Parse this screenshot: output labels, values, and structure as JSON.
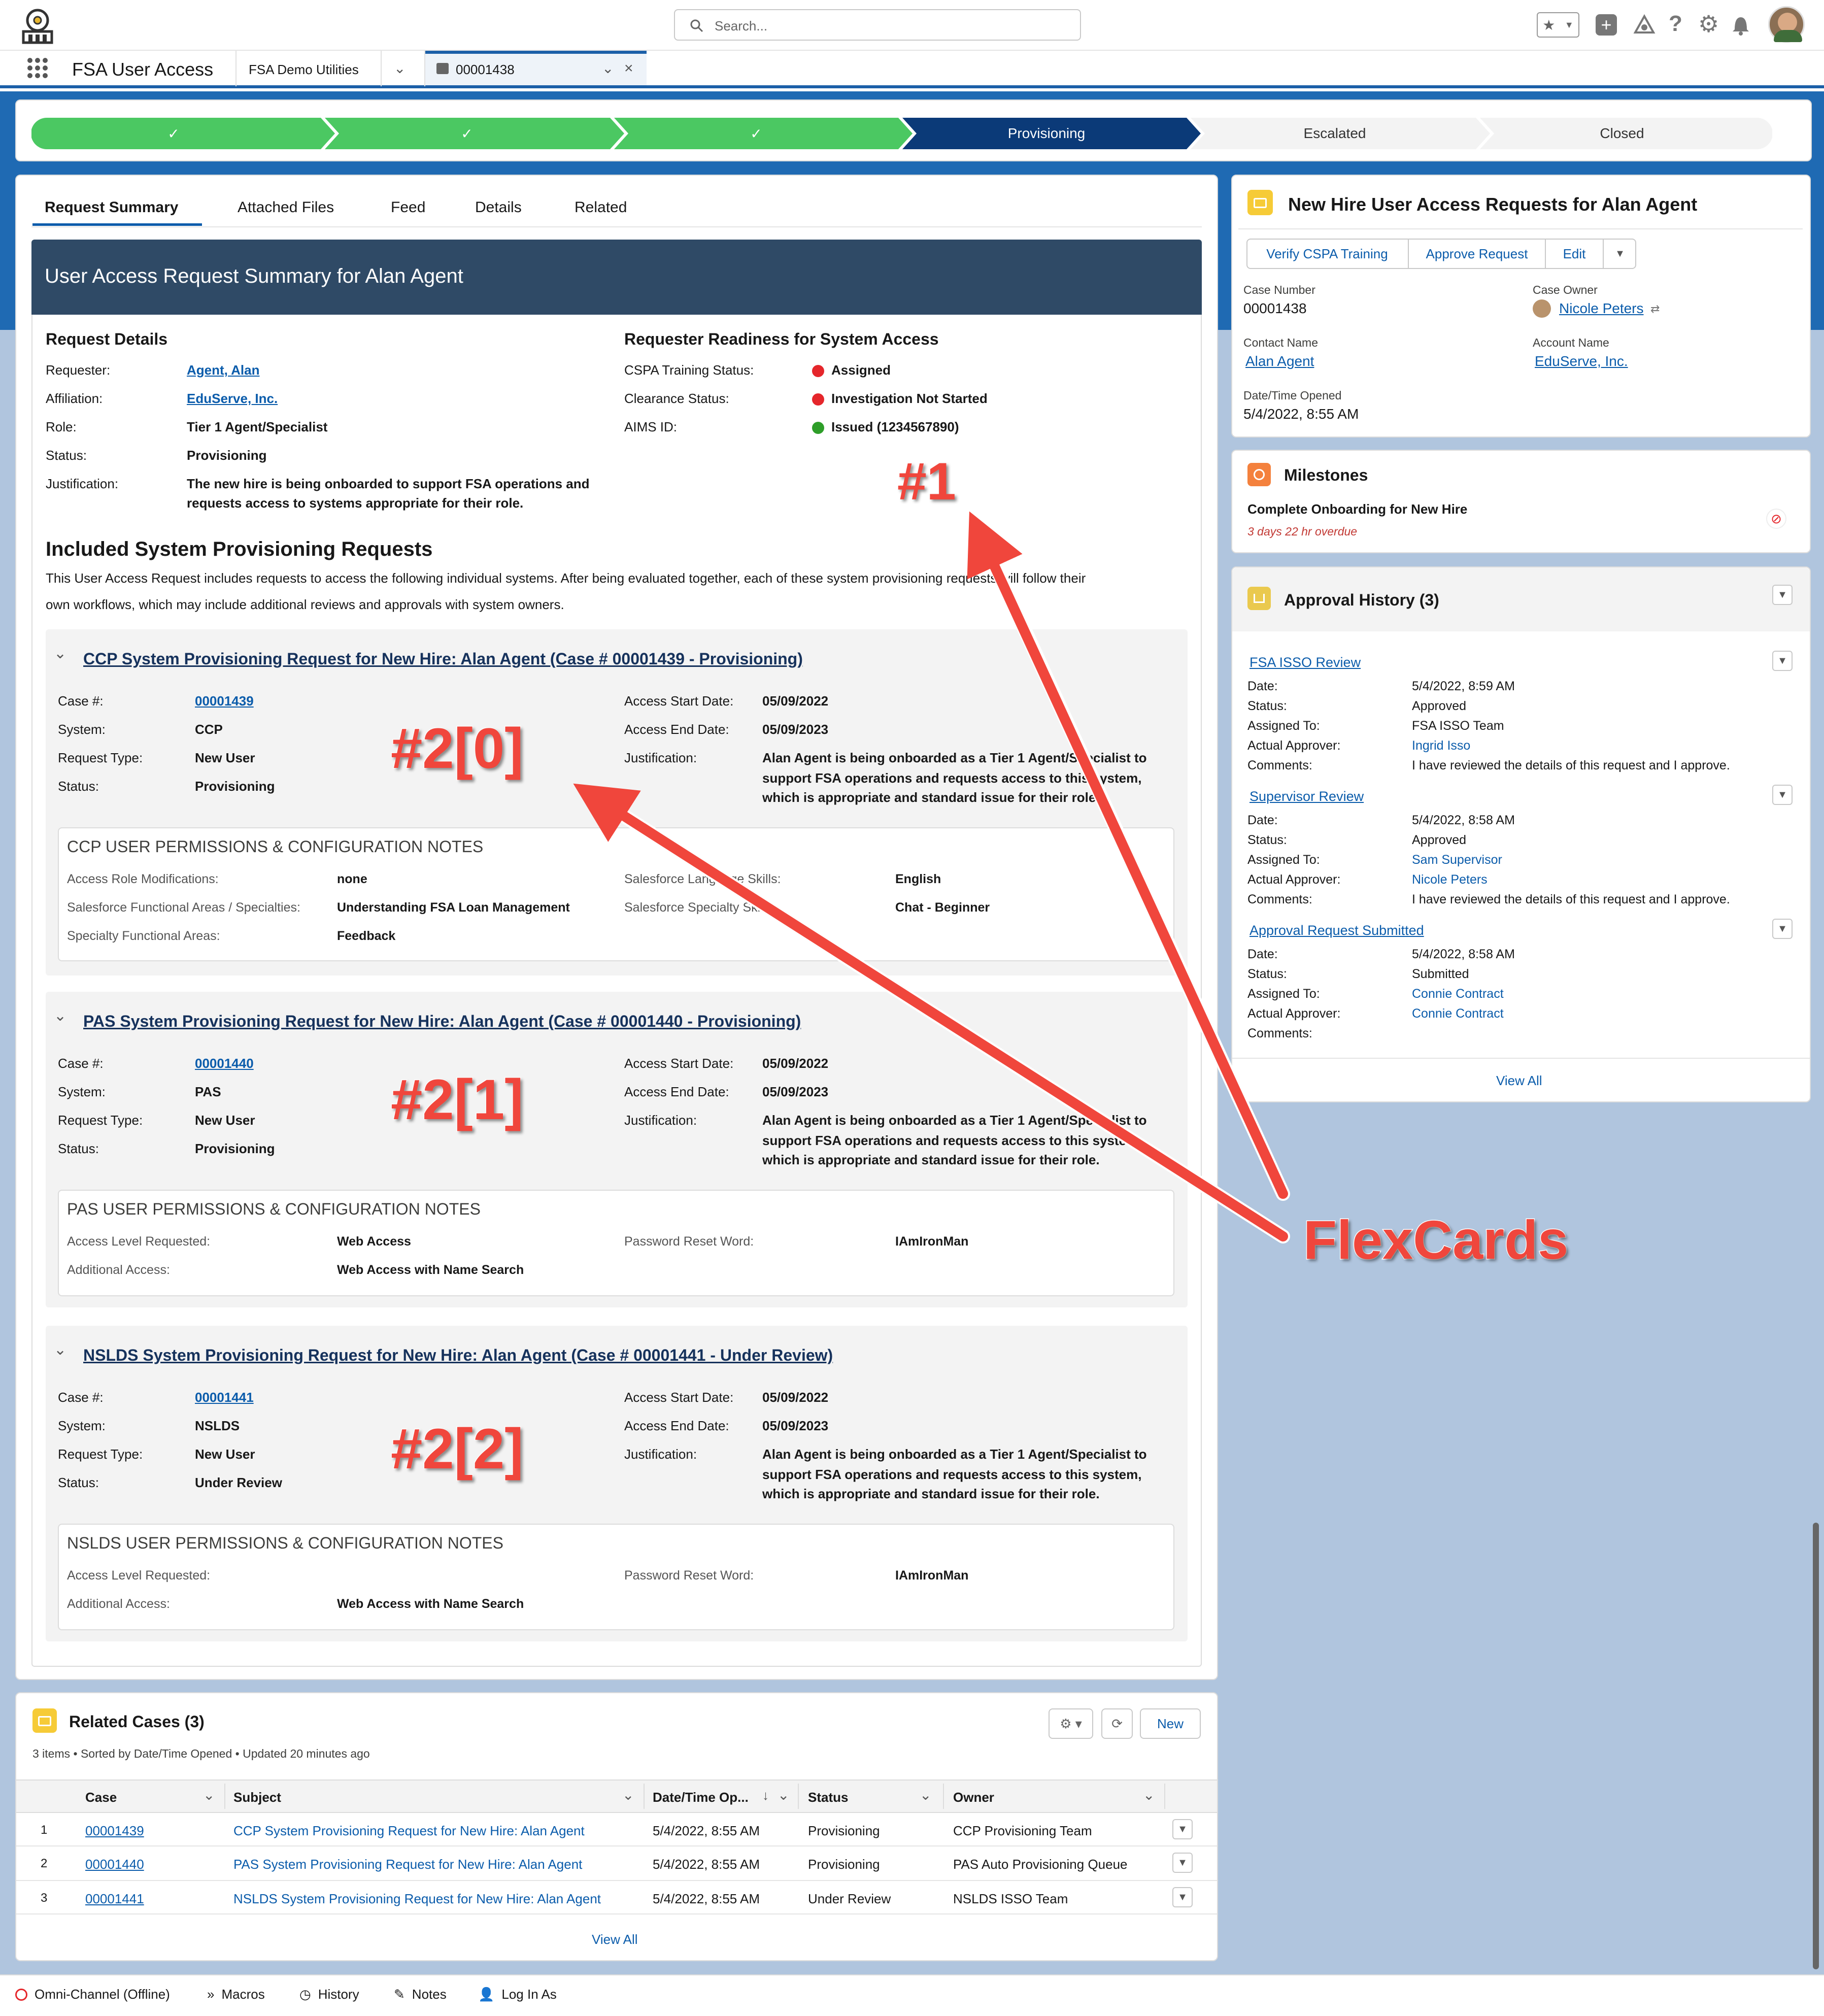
{
  "header": {
    "search_placeholder": "Search..."
  },
  "nav": {
    "app_name": "FSA User Access",
    "tab1": "FSA Demo Utilities",
    "tab2": "00001438"
  },
  "path": {
    "steps": [
      "✓",
      "✓",
      "✓",
      "Provisioning",
      "Escalated",
      "Closed"
    ]
  },
  "tabs": [
    "Request Summary",
    "Attached Files",
    "Feed",
    "Details",
    "Related"
  ],
  "summary": {
    "banner": "User Access Request Summary for Alan Agent",
    "details_title": "Request Details",
    "readiness_title": "Requester Readiness for System Access",
    "details": [
      {
        "label": "Requester:",
        "value": "Agent, Alan"
      },
      {
        "label": "Affiliation:",
        "value": "EduServe, Inc."
      },
      {
        "label": "Role:",
        "value": "Tier 1 Agent/Specialist"
      },
      {
        "label": "Status:",
        "value": "Provisioning"
      },
      {
        "label": "Justification:",
        "value": "The new hire is being onboarded to support FSA operations and",
        "value2": "requests access to systems appropriate for their role."
      }
    ],
    "readiness": [
      {
        "label": "CSPA Training Status:",
        "value": "Assigned",
        "color": "#e5262b"
      },
      {
        "label": "Clearance Status:",
        "value": "Investigation Not Started",
        "color": "#e5262b"
      },
      {
        "label": "AIMS ID:",
        "value": "Issued (1234567890)",
        "color": "#2e9e29"
      }
    ],
    "included_title": "Included System Provisioning Requests",
    "included_text1": "This User Access Request includes requests to access the following individual systems.  After being evaluated together, each of these system provisioning requests will follow their",
    "included_text2": "own workflows, which may include additional reviews and approvals with system owners."
  },
  "labels": {
    "case": "Case #:",
    "system": "System:",
    "req_type": "Request Type:",
    "status": "Status:",
    "start": "Access Start Date:",
    "end": "Access End Date:",
    "just": "Justification:"
  },
  "systems": [
    {
      "title": "CCP System Provisioning Request for New Hire: Alan Agent (Case # 00001439 - Provisioning)",
      "case": "00001439",
      "system": "CCP",
      "req_type": "New User",
      "status": "Provisioning",
      "start": "05/09/2022",
      "end": "05/09/2023",
      "just1": "Alan Agent is being onboarded as a Tier 1 Agent/Specialist to",
      "just2": "support FSA operations and requests access to this system,",
      "just3": "which is appropriate and standard issue for their role.",
      "notes_title": "CCP USER PERMISSIONS & CONFIGURATION NOTES",
      "notes": [
        {
          "l": "Access Role Modifications:",
          "v": "none",
          "l2": "Salesforce Language Skills:",
          "v2": "English"
        },
        {
          "l": "Salesforce Functional Areas / Specialties:",
          "v": "Understanding FSA Loan Management",
          "l2": "Salesforce Specialty Skills:",
          "v2": "Chat - Beginner"
        },
        {
          "l": "Specialty Functional Areas:",
          "v": "Feedback",
          "l2": "",
          "v2": ""
        }
      ]
    },
    {
      "title": "PAS System Provisioning Request for New Hire: Alan Agent (Case # 00001440 - Provisioning)",
      "case": "00001440",
      "system": "PAS",
      "req_type": "New User",
      "status": "Provisioning",
      "start": "05/09/2022",
      "end": "05/09/2023",
      "just1": "Alan Agent is being onboarded as a Tier 1 Agent/Specialist to",
      "just2": "support FSA operations and requests access to this system,",
      "just3": "which is appropriate and standard issue for their role.",
      "notes_title": "PAS USER PERMISSIONS & CONFIGURATION NOTES",
      "notes": [
        {
          "l": "Access Level Requested:",
          "v": "Web Access",
          "l2": "Password Reset Word:",
          "v2": "IAmIronMan"
        },
        {
          "l": "Additional Access:",
          "v": "Web Access with Name Search",
          "l2": "",
          "v2": ""
        }
      ]
    },
    {
      "title": "NSLDS System Provisioning Request for New Hire: Alan Agent (Case # 00001441 - Under Review)",
      "case": "00001441",
      "system": "NSLDS",
      "req_type": "New User",
      "status": "Under Review",
      "start": "05/09/2022",
      "end": "05/09/2023",
      "just1": "Alan Agent is being onboarded as a Tier 1 Agent/Specialist to",
      "just2": "support FSA operations and requests access to this system,",
      "just3": "which is appropriate and standard issue for their role.",
      "notes_title": "NSLDS USER PERMISSIONS & CONFIGURATION NOTES",
      "notes": [
        {
          "l": "Access Level Requested:",
          "v": "",
          "l2": "Password Reset Word:",
          "v2": "IAmIronMan"
        },
        {
          "l": "Additional Access:",
          "v": "Web Access with Name Search",
          "l2": "",
          "v2": ""
        }
      ]
    }
  ],
  "highlights": {
    "title": "New Hire User Access Requests for Alan Agent",
    "btn1": "Verify CSPA Training",
    "btn2": "Approve Request",
    "btn3": "Edit",
    "case_number_label": "Case Number",
    "case_number": "00001438",
    "owner_label": "Case Owner",
    "owner": "Nicole Peters",
    "contact_label": "Contact Name",
    "contact": "Alan Agent",
    "account_label": "Account Name",
    "account": "EduServe, Inc.",
    "opened_label": "Date/Time Opened",
    "opened": "5/4/2022, 8:55 AM"
  },
  "milestones": {
    "title": "Milestones",
    "item": "Complete Onboarding for New Hire",
    "overdue": "3 days 22 hr overdue"
  },
  "approval": {
    "title": "Approval History (3)",
    "view_all": "View All",
    "labels": [
      "Date:",
      "Status:",
      "Assigned To:",
      "Actual Approver:",
      "Comments:"
    ],
    "items": [
      {
        "name": "FSA ISSO Review",
        "date": "5/4/2022, 8:59 AM",
        "status": "Approved",
        "assigned": "FSA ISSO Team",
        "approver": "Ingrid Isso",
        "comments": "I have reviewed the details of this request and I approve."
      },
      {
        "name": "Supervisor Review",
        "date": "5/4/2022, 8:58 AM",
        "status": "Approved",
        "assigned": "Sam Supervisor",
        "approver": "Nicole Peters",
        "comments": "I have reviewed the details of this request and I approve."
      },
      {
        "name": "Approval Request Submitted",
        "date": "5/4/2022, 8:58 AM",
        "status": "Submitted",
        "assigned": "Connie Contract",
        "approver": "Connie Contract",
        "comments": ""
      }
    ]
  },
  "related": {
    "title": "Related Cases (3)",
    "meta": "3 items • Sorted by Date/Time Opened • Updated 20 minutes ago",
    "new": "New",
    "view_all": "View All",
    "columns": [
      "Case",
      "Subject",
      "Date/Time Op...",
      "Status",
      "Owner"
    ],
    "rows": [
      {
        "n": "1",
        "case": "00001439",
        "subject": "CCP System Provisioning Request for New Hire: Alan Agent",
        "date": "5/4/2022, 8:55 AM",
        "status": "Provisioning",
        "owner": "CCP Provisioning Team"
      },
      {
        "n": "2",
        "case": "00001440",
        "subject": "PAS System Provisioning Request for New Hire: Alan Agent",
        "date": "5/4/2022, 8:55 AM",
        "status": "Provisioning",
        "owner": "PAS Auto Provisioning Queue"
      },
      {
        "n": "3",
        "case": "00001441",
        "subject": "NSLDS System Provisioning Request for New Hire: Alan Agent",
        "date": "5/4/2022, 8:55 AM",
        "status": "Under Review",
        "owner": "NSLDS ISSO Team"
      }
    ]
  },
  "footer": {
    "items": [
      "Omni-Channel (Offline)",
      "Macros",
      "History",
      "Notes",
      "Log In As"
    ]
  },
  "annotations": {
    "a1": "#1",
    "a2_0": "#2[0]",
    "a2_1": "#2[1]",
    "a2_2": "#2[2]",
    "flex": "FlexCards"
  },
  "colors": {
    "brand_blue": "#1f6ab3",
    "path_complete": "#4bc862",
    "path_current": "#0b3a78",
    "link": "#0b5cab",
    "annotation": "#f0463c"
  }
}
